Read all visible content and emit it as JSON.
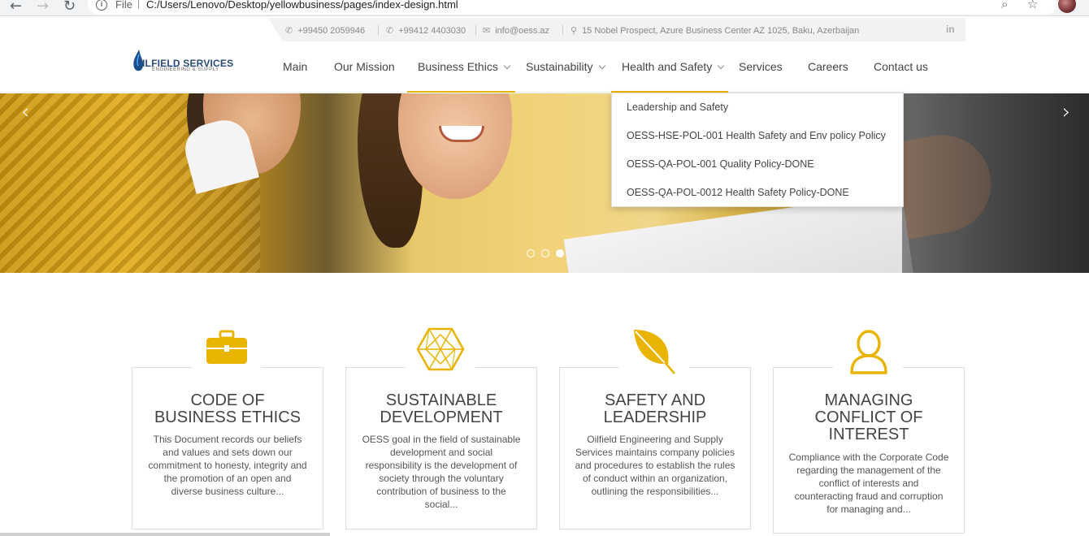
{
  "browser": {
    "file_label": "File",
    "url": "C:/Users/Lenovo/Desktop/yellowbusiness/pages/index-design.html"
  },
  "topbar": {
    "phone1": "+99450 2059946",
    "phone2": "+99412 4403030",
    "email": "info@oess.az",
    "address": "15 Nobel Prospect, Azure Business Center AZ 1025, Baku, Azerbaijan",
    "social": "in"
  },
  "logo": {
    "name": "ILFIELD SERVICES",
    "sub": "ENGINEERING & SUPPLY"
  },
  "nav": {
    "items": [
      {
        "label": "Main"
      },
      {
        "label": "Our Mission"
      },
      {
        "label": "Business Ethics"
      },
      {
        "label": "Sustainability"
      },
      {
        "label": "Health and Safety"
      },
      {
        "label": "Services"
      },
      {
        "label": "Careers"
      },
      {
        "label": "Contact us"
      }
    ],
    "accent": "#e8b400"
  },
  "dropdown": {
    "items": [
      {
        "label": "Leadership and Safety"
      },
      {
        "label": "OESS-HSE-POL-001 Health Safety and Env policy Policy"
      },
      {
        "label": "OESS-QA-POL-001 Quality Policy-DONE"
      },
      {
        "label": "OESS-QA-POL-0012 Health Safety Policy-DONE"
      }
    ]
  },
  "slider": {
    "prev": "‹",
    "next": "›",
    "dots": 3,
    "active_dot": 3
  },
  "cards": [
    {
      "title_line1": "CODE OF",
      "title_line2": "BUSINESS ETHICS",
      "title_line3": "",
      "text": "This Document records our beliefs and values and sets down our commitment to honesty, integrity and the promotion of an open and diverse business culture...",
      "icon": "briefcase-icon"
    },
    {
      "title_line1": "SUSTAINABLE",
      "title_line2": "DEVELOPMENT",
      "title_line3": "",
      "text": "OESS goal in the field of sustainable development and social responsibility is the development of society through the voluntary contribution of business to the social...",
      "icon": "geodesic-icon"
    },
    {
      "title_line1": "SAFETY AND",
      "title_line2": "LEADERSHIP",
      "title_line3": "",
      "text": "Oilfield Engineering and Supply Services maintains company policies and procedures to establish the rules of conduct within an organization, outlining the responsibilities...",
      "icon": "leaf-icon"
    },
    {
      "title_line1": "MANAGING",
      "title_line2": "CONFLICT OF",
      "title_line3": "INTEREST",
      "text": "Compliance with the Corporate Code regarding the management of the conflict of interests and counteracting fraud and corruption for managing and...",
      "icon": "user-icon"
    }
  ]
}
